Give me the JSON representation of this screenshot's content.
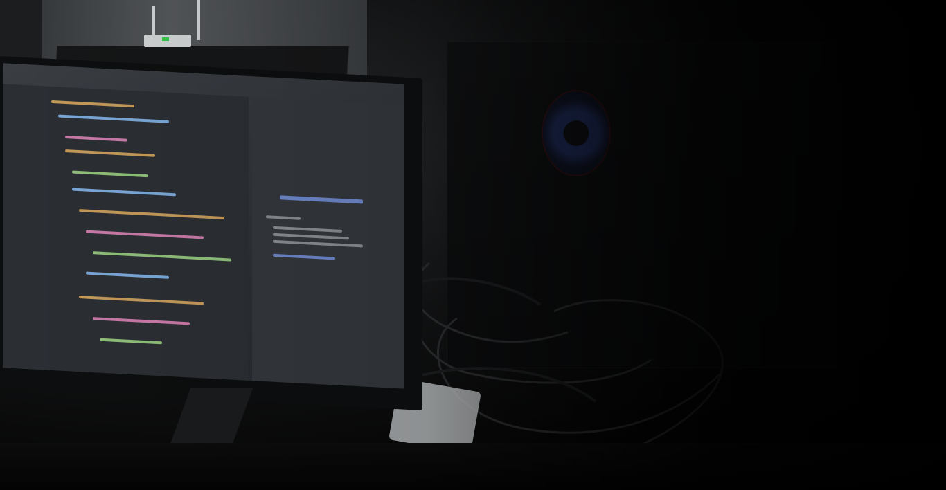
{
  "scene": {
    "kind": "photo",
    "subject": "monitor-with-code-editor-and-pc-case",
    "colors": {
      "dark": "#050505",
      "screen": "#2c3035",
      "accent_blue": "#1d2a55",
      "led_green": "#35c84a"
    }
  }
}
